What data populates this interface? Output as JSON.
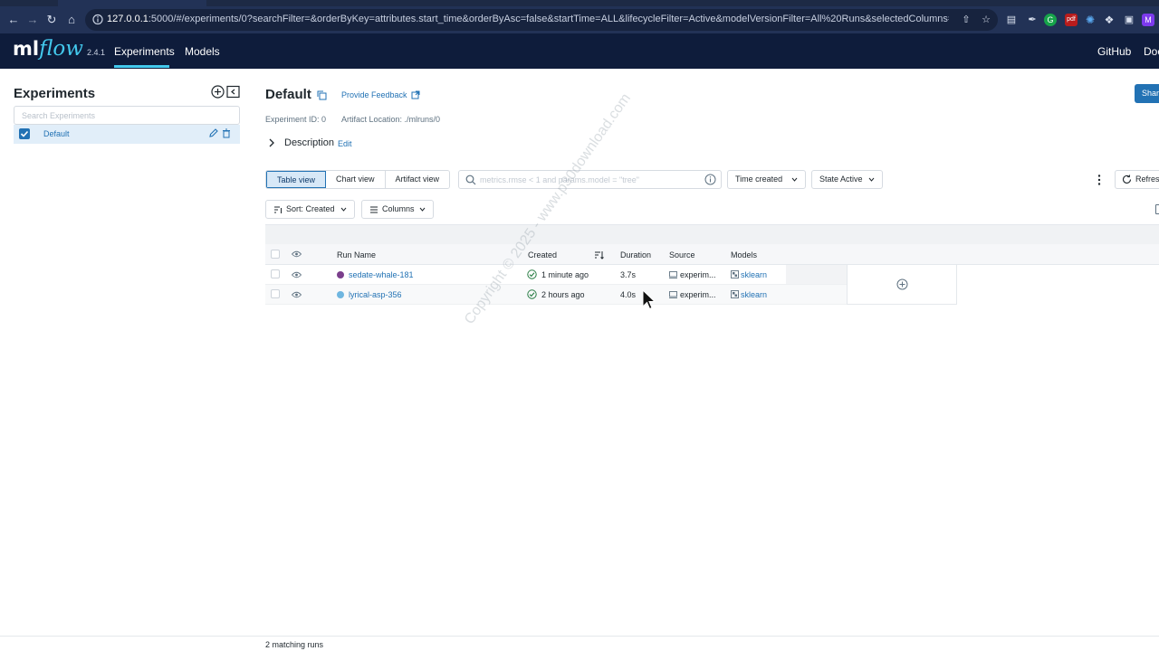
{
  "browser": {
    "url_host": "127.0.0.1",
    "url_rest": ":5000/#/experiments/0?searchFilter=&orderByKey=attributes.start_time&orderByAsc=false&startTime=ALL&lifecycleFilter=Active&modelVersionFilter=All%20Runs&selectedColumns=attributes.%6...",
    "ext_g": "G",
    "ext_pdf": "pdf",
    "profile": "M"
  },
  "header": {
    "logo_ml": "ml",
    "logo_flow": "flow",
    "version": "2.4.1",
    "nav": [
      "Experiments",
      "Models"
    ],
    "right_links": [
      "GitHub",
      "Docs"
    ]
  },
  "sidebar": {
    "title": "Experiments",
    "search_placeholder": "Search Experiments",
    "items": [
      {
        "label": "Default"
      }
    ]
  },
  "experiment": {
    "title": "Default",
    "feedback": "Provide Feedback",
    "share": "Share",
    "id_text": "Experiment ID: 0",
    "artifact_text": "Artifact Location: ./mlruns/0",
    "description_label": "Description",
    "edit_label": "Edit"
  },
  "toolbar": {
    "views": [
      "Table view",
      "Chart view",
      "Artifact view"
    ],
    "filter_placeholder": "metrics.rmse < 1 and params.model = \"tree\"",
    "time_created": "Time created",
    "state": "State Active",
    "refresh": "Refresh",
    "sort": "Sort: Created",
    "columns": "Columns"
  },
  "table": {
    "headers": [
      "Run Name",
      "Created",
      "Duration",
      "Source",
      "Models"
    ],
    "rows": [
      {
        "run_name": "sedate-whale-181",
        "color": "#7b3f8c",
        "created": "1 minute ago",
        "duration": "3.7s",
        "source": "experim...",
        "model": "sklearn"
      },
      {
        "run_name": "lyrical-asp-356",
        "color": "#6fb6e0",
        "created": "2 hours ago",
        "duration": "4.0s",
        "source": "experim...",
        "model": "sklearn"
      }
    ]
  },
  "footer": {
    "count": "2 matching runs"
  },
  "watermark": "Copyright © 2025 - www.p30download.com",
  "colors": {
    "accent": "#2272b4",
    "header": "#0e1c3b",
    "logo_flow": "#43c9ed"
  }
}
